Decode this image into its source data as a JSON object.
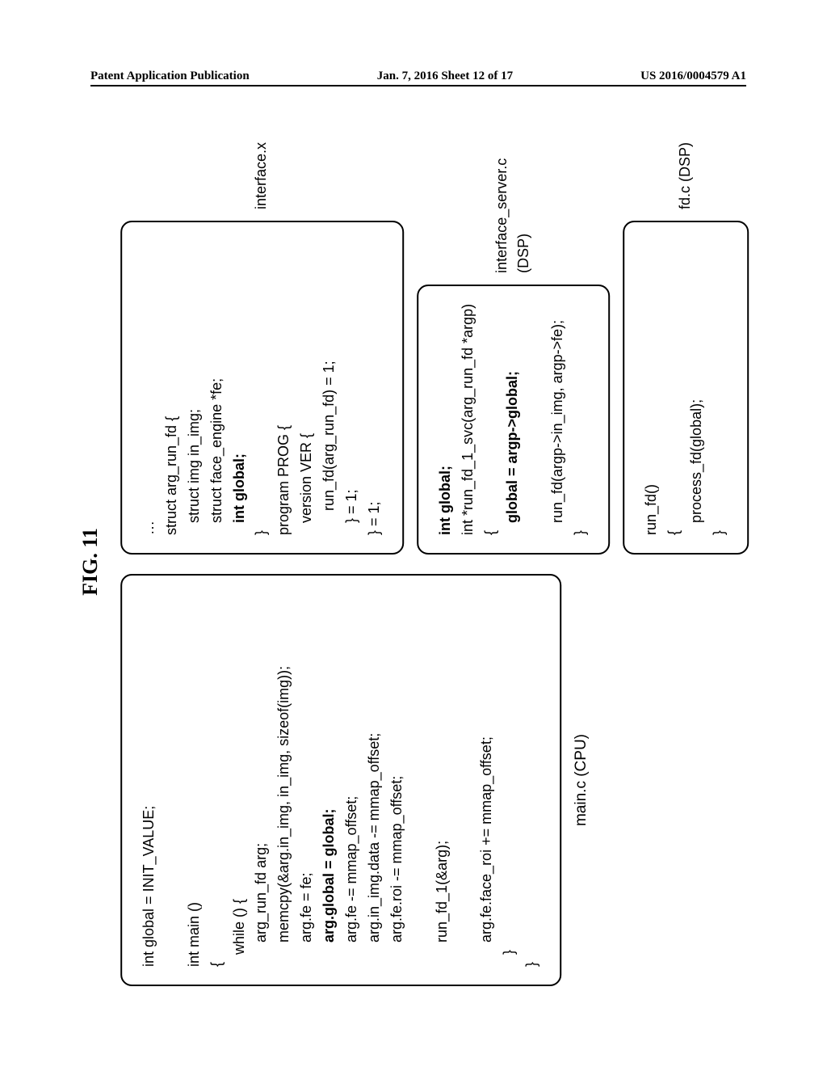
{
  "header": {
    "left": "Patent Application Publication",
    "center": "Jan. 7, 2016   Sheet 12 of 17",
    "right": "US 2016/0004579 A1"
  },
  "figureTitle": "FIG.  11",
  "left": {
    "l1": "int global = INIT_VALUE;",
    "l2": "int main ()",
    "l3": "{",
    "l4": "   while () {",
    "l5": "      arg_run_fd arg;",
    "l6": "      memcpy(&arg.in_img, in_img, sizeof(img));",
    "l7": "      arg.fe = fe;",
    "l8b": "      arg.global = global;",
    "l9": "      arg.fe -= mmap_offset;",
    "l10": "      arg.in_img.data -= mmap_offset;",
    "l11": "      arg.fe.roi -= mmap_offset;",
    "l12": "",
    "l13": "      run_fd_1(&arg);",
    "l14": "",
    "l15": "      arg.fe.face_roi += mmap_offset;",
    "l16": "   }",
    "l17": "}",
    "label": "main.c (CPU)"
  },
  "r1": {
    "l0": "…",
    "l1": "struct arg_run_fd {",
    "l2": "   struct img in_img;",
    "l3": "   struct face_engine *fe;",
    "l4b": "   int global;",
    "l5": "}",
    "l6": "program PROG {",
    "l7": "   version VER {",
    "l8": "      run_fd(arg_run_fd) = 1;",
    "l9": "   } = 1;",
    "l10": "} = 1;",
    "label": "interface.x"
  },
  "r2": {
    "l1b": "int global;",
    "l2": "int *run_fd_1_svc(arg_run_fd *argp)",
    "l3": "{",
    "l4b": "   global = argp->global;",
    "l5": "",
    "l6": "   run_fd(argp->in_img, argp->fe);",
    "l7": "}",
    "label": "interface_server.c (DSP)"
  },
  "r3": {
    "l1": "run_fd()",
    "l2": "{",
    "l3": "   process_fd(global);",
    "l4": "}",
    "label": "fd.c (DSP)"
  }
}
